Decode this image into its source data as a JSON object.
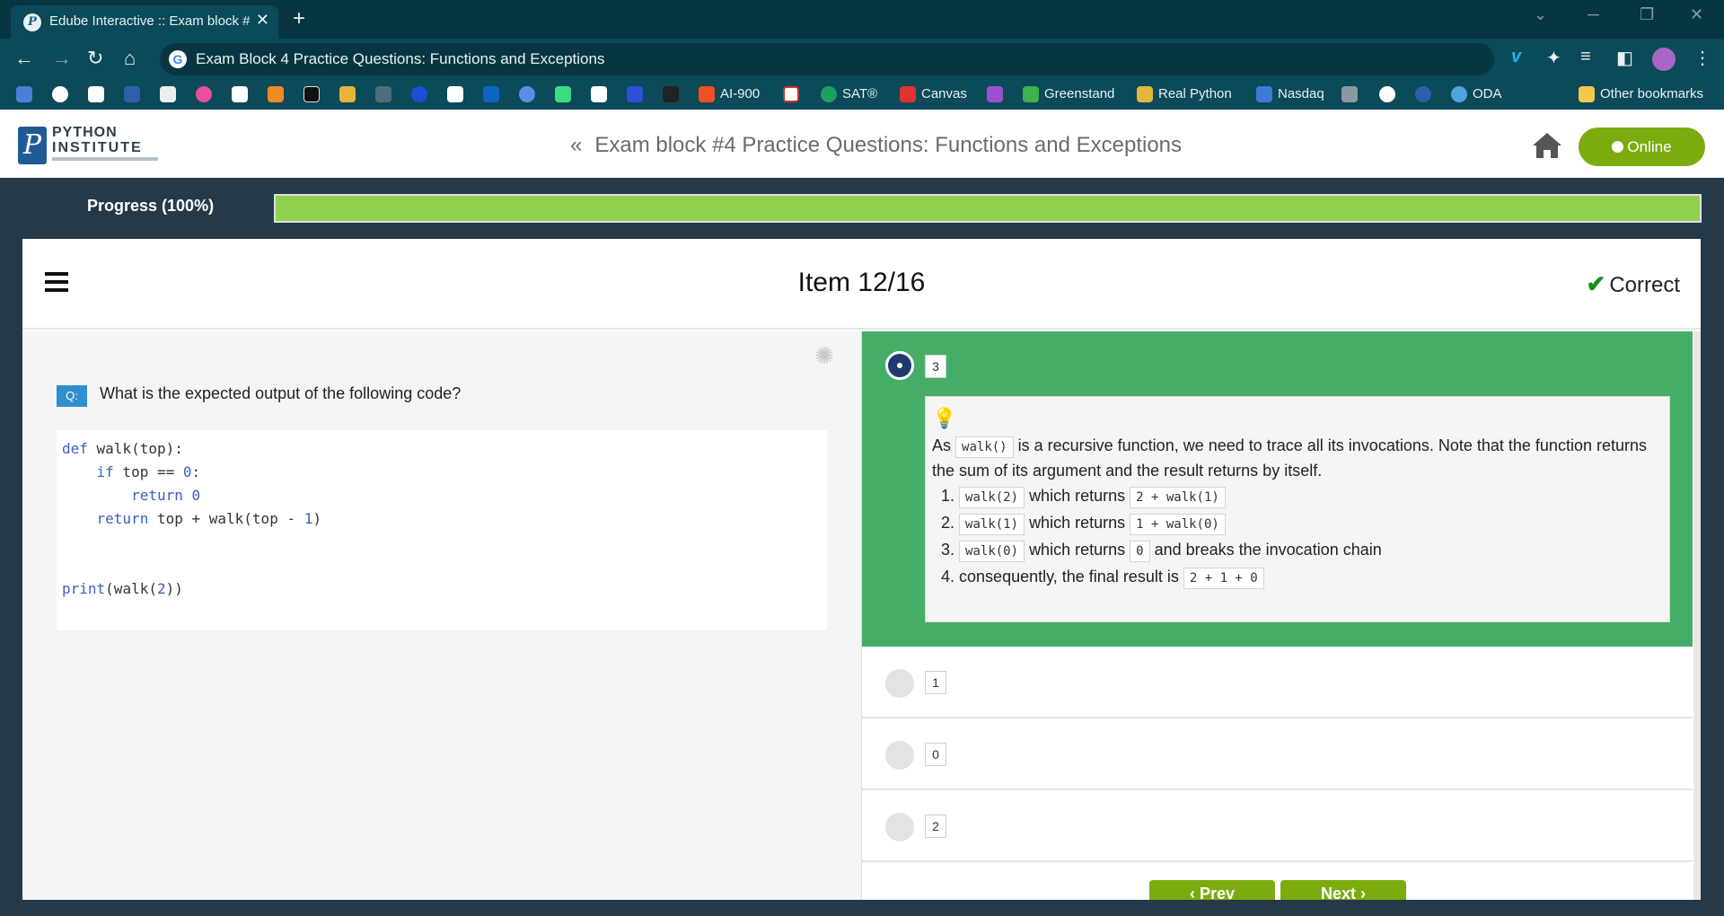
{
  "browser": {
    "tab_title": "Edube Interactive :: Exam block #",
    "tab_close": "✕",
    "new_tab": "+",
    "url": "Exam Block 4 Practice Questions: Functions and Exceptions",
    "bookmarks": [
      {
        "label": "AI-900",
        "color": "#f25022"
      },
      {
        "label": "SAT®",
        "color": "#1aa260"
      },
      {
        "label": "Canvas",
        "color": "#e13232"
      },
      {
        "label": "Greenstand",
        "color": "#3fb24f"
      },
      {
        "label": "Real Python",
        "color": "#e4b63a"
      },
      {
        "label": "Nasdaq",
        "color": "#3a7bd5"
      },
      {
        "label": "ODA",
        "color": "#4fa3e0"
      },
      {
        "label": "Other bookmarks",
        "color": "#f2c94c"
      }
    ]
  },
  "header": {
    "logo_line1": "PYTHON",
    "logo_line2": "INSTITUTE",
    "logo_letter": "P",
    "back_chevron": "«",
    "title": "Exam block #4 Practice Questions: Functions and Exceptions",
    "online_label": "Online"
  },
  "progress": {
    "label": "Progress (100%)",
    "percent": 100
  },
  "item": {
    "title": "Item 12/16",
    "status": "Correct",
    "status_icon": "check-icon"
  },
  "question": {
    "badge": "Q:",
    "text": "What is the expected output of the following code?"
  },
  "answers": [
    {
      "label": "3",
      "selected": true,
      "correct": true
    },
    {
      "label": "1",
      "selected": false
    },
    {
      "label": "0",
      "selected": false
    },
    {
      "label": "2",
      "selected": false
    }
  ],
  "explanation": {
    "intro_before": "As",
    "intro_code": "walk()",
    "intro_after": "is a recursive function, we need to trace all its invocations. Note that the function returns the sum of its argument and the result returns by itself.",
    "steps": [
      {
        "num": "1.",
        "code1": "walk(2)",
        "text": "which returns",
        "code2": "2 + walk(1)",
        "tail": ""
      },
      {
        "num": "2.",
        "code1": "walk(1)",
        "text": "which returns",
        "code2": "1 + walk(0)",
        "tail": ""
      },
      {
        "num": "3.",
        "code1": "walk(0)",
        "text": "which returns",
        "code2": "0",
        "tail": "and breaks the invocation chain"
      },
      {
        "num": "4.",
        "text": "consequently, the final result is",
        "code2": "2 + 1 + 0"
      }
    ]
  },
  "nav": {
    "prev_label": "‹ Prev",
    "next_label": "Next ›"
  }
}
